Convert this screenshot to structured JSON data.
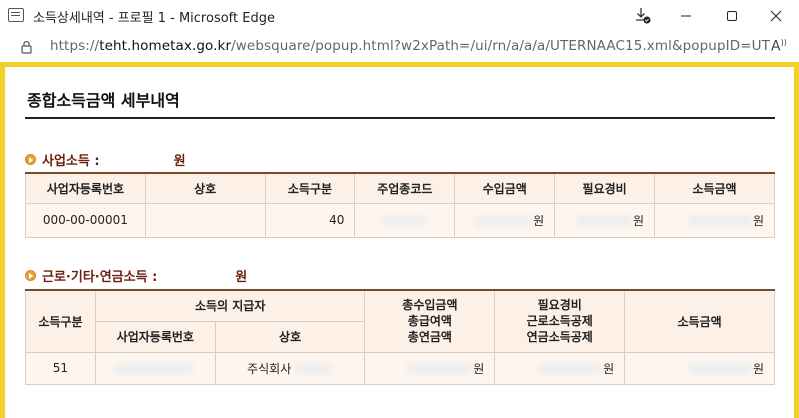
{
  "window": {
    "title": "소득상세내역 - 프로필 1 - Microsoft Edge",
    "url_prefix": "https://",
    "url_host": "teht.hometax.go.kr",
    "url_path": "/websquare/popup.html?w2xPath=/ui/rn/a/a/a/UTERNAAC15.xml&popupID=UTERN..."
  },
  "page": {
    "title": "종합소득금액 세부내역"
  },
  "business": {
    "title": "사업소득 :",
    "unit": "원",
    "headers": [
      "사업자등록번호",
      "상호",
      "소득구분",
      "주업종코드",
      "수입금액",
      "필요경비",
      "소득금액"
    ],
    "row": {
      "reg_no": "000-00-00001",
      "name": "",
      "type": "40",
      "unit_income": "원",
      "unit_expense": "원",
      "unit_amount": "원"
    }
  },
  "labor": {
    "title": "근로·기타·연금소득 :",
    "unit": "원",
    "header_type": "소득구분",
    "header_payer": "소득의 지급자",
    "header_regno": "사업자등록번호",
    "header_name": "상호",
    "header_income_lines": [
      "총수입금액",
      "총급여액",
      "총연금액"
    ],
    "header_expense_lines": [
      "필요경비",
      "근로소득공제",
      "연금소득공제"
    ],
    "header_amount": "소득금액",
    "row": {
      "type": "51",
      "name": "주식회사",
      "unit_income": "원",
      "unit_expense": "원",
      "unit_amount": "원"
    }
  }
}
